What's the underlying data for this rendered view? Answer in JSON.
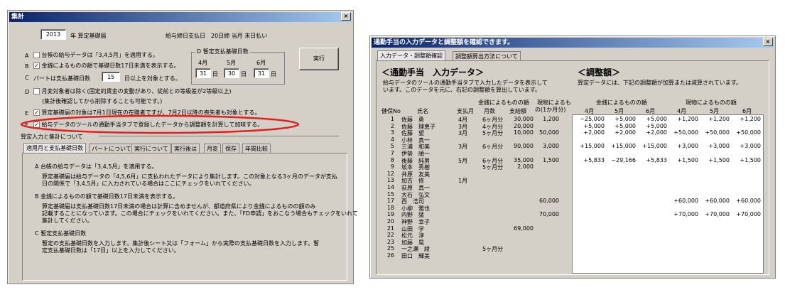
{
  "left": {
    "title": "集計",
    "close": "×",
    "year": "2013",
    "year_suffix": "年 算定基礎届",
    "pay_info": "給与締日支払日　20日締 当月 末日払い",
    "optA": "台帳の給与データは「3,4,5月」を適用する。",
    "optB": "金銭によるものの額で基礎日数17日未満を表示する。",
    "optC_pre": "パートは支払基礎日数",
    "optC_val": "15",
    "optC_post": "日以上を対象とする。",
    "groupD_title": "D 暫定支払基礎日数",
    "months": [
      "4月",
      "5月",
      "6月"
    ],
    "day_vals": [
      "31",
      "30",
      "31"
    ],
    "day_unit": "日",
    "run_button": "実行",
    "optD_line1": "月変対象者は除く(固定的賃金の変動があり、従前との等級差が2等級以上)",
    "optD_line2": "(集計後確認してから削除することも可能です。)",
    "optE": "算定基礎届の対象は7月1日現在の在職者ですが、7月2日以降の喪失者も対象とする。",
    "optF": "給与データのツールの通勤手当タブで登録したデータから調整額を計算して加味する。",
    "letters": [
      "A",
      "B",
      "C",
      "D",
      "E",
      "F"
    ],
    "section_title": "算定入力と集計について",
    "tabs": [
      "適用月と支払基礎日数",
      "パートについて",
      "実行について",
      "実行後は",
      "月変",
      "保存",
      "年間比較"
    ],
    "help": [
      {
        "head": "A 台帳の給与データは「3,4,5月」を適用する。",
        "body": [
          "算定基礎届は給与データの「4,5,6月」に支払われたデータにより集計します。この対象となる3ヶ月のデータが支払",
          "日の関係で「3,4,5月」に入力されている場合はここにチェックをいれてください。"
        ]
      },
      {
        "head": "B 金銭によるものの額で基礎日数17日未満を表示する。",
        "body": [
          "算定基礎届は支払基礎日数17日未満の場合は計算に含めませんが、都道府県により金銭によるものの額のみ",
          "記載することになっています。この場合にチェックをいれてください。また、「FD申請」をおこなう場合もチェックをいれて",
          "集計してください。"
        ]
      },
      {
        "head": "C 暫定支払基礎日数",
        "body": [
          "暫定の支払基礎日数を入力します。集計後シート又は「フォーム」から実際の支払基礎日数を入力します。暫",
          "定支払基礎日数は「17日」以上を入力してください。"
        ]
      }
    ]
  },
  "right": {
    "title": "通勤手当の入力データと調整額を確認できます。",
    "close": "×",
    "tabs": [
      "入力データ・調整額確認",
      "調整額算出方法について"
    ],
    "heading_left": "＜通勤手当　入力データ＞",
    "desc_left": [
      "給与データのツールの通勤手当タブで入力したデータを表示して",
      "います。このデータを元に、右記の調整額を算出しています。"
    ],
    "heading_right": "＜調整額＞",
    "desc_right": "算定データには、下記の調整額が加算または減算されています。",
    "hdr_kinsen": "金銭によるものの額",
    "hdr_genbutsu": "現物によるも",
    "hdr_genbutsu2": "の(1か月分)",
    "hdr_cols": [
      "健保No",
      "氏名",
      "支払月",
      "月数",
      "支給額"
    ],
    "adj_hdr_kinsen": "金銭によるものの額",
    "adj_hdr_genbutsu": "現物によるものの額",
    "adj_months": [
      "4月",
      "5月",
      "6月",
      "4月",
      "5月",
      "6月"
    ],
    "rows": [
      {
        "no": "1",
        "name": "佐藤　勇",
        "m": "4月",
        "cnt": "6ヶ月分",
        "amt": "30,000",
        "gen": "1,200"
      },
      {
        "no": "2",
        "name": "佐藤　理恵子",
        "m": "3月",
        "cnt": "4ヶ月分",
        "amt": "20,000",
        "gen": ""
      },
      {
        "no": "3",
        "name": "佐藤　望",
        "m": "3月",
        "cnt": "5ヶ月分",
        "amt": "10,000",
        "gen": "50,000"
      },
      {
        "no": "4",
        "name": "小林　真一",
        "m": "",
        "cnt": "",
        "amt": "",
        "gen": ""
      },
      {
        "no": "5",
        "name": "三浦　和美",
        "m": "3月",
        "cnt": "6ヶ月分",
        "amt": "90,000",
        "gen": "3,000"
      },
      {
        "no": "7",
        "name": "伊勢　順一",
        "m": "",
        "cnt": "",
        "amt": "",
        "gen": ""
      },
      {
        "no": "8",
        "name": "後藤　純男",
        "m": "5月",
        "cnt": "6ヶ月分",
        "amt": "35,000",
        "gen": "1,500"
      },
      {
        "no": "9",
        "name": "坂本　秀樹",
        "m": "",
        "cnt": "5ヶ月分",
        "amt": "2,000",
        "gen": ""
      },
      {
        "no": "12",
        "name": "井原　友美",
        "m": "",
        "cnt": "",
        "amt": "",
        "gen": ""
      },
      {
        "no": "13",
        "name": "加古　修",
        "m": "1月",
        "cnt": "",
        "amt": "",
        "gen": ""
      },
      {
        "no": "14",
        "name": "荻原　真一",
        "m": "",
        "cnt": "",
        "amt": "",
        "gen": ""
      },
      {
        "no": "15",
        "name": "大石　弘文",
        "m": "",
        "cnt": "",
        "amt": "",
        "gen": ""
      },
      {
        "no": "17",
        "name": "西　浩司",
        "m": "",
        "cnt": "",
        "amt": "",
        "gen": "60,000"
      },
      {
        "no": "18",
        "name": "小柳　雅也",
        "m": "",
        "cnt": "",
        "amt": "",
        "gen": ""
      },
      {
        "no": "19",
        "name": "内野　猛",
        "m": "",
        "cnt": "",
        "amt": "",
        "gen": "70,000"
      },
      {
        "no": "20",
        "name": "神野　幸子",
        "m": "",
        "cnt": "",
        "amt": "",
        "gen": ""
      },
      {
        "no": "21",
        "name": "山田　学",
        "m": "",
        "cnt": "",
        "amt": "69,000",
        "gen": ""
      },
      {
        "no": "22",
        "name": "松元　淳",
        "m": "",
        "cnt": "",
        "amt": "",
        "gen": ""
      },
      {
        "no": "23",
        "name": "加藤　晃",
        "m": "",
        "cnt": "",
        "amt": "",
        "gen": ""
      },
      {
        "no": "25",
        "name": "一之瀬　綾",
        "m": "",
        "cnt": "5ヶ月分",
        "amt": "",
        "gen": ""
      },
      {
        "no": "26",
        "name": "田口　輝美",
        "m": "",
        "cnt": "",
        "amt": "",
        "gen": ""
      }
    ],
    "adj_rows": [
      [
        "−25,000",
        "+5,000",
        "+5,000",
        "+1,200",
        "+1,200",
        "+1,200"
      ],
      [
        "+5,000",
        "+5,000",
        "+5,000",
        "",
        "",
        ""
      ],
      [
        "+2,000",
        "+2,000",
        "+2,000",
        "+50,000",
        "+50,000",
        "+50,000"
      ],
      [
        "",
        "",
        "",
        "",
        "",
        ""
      ],
      [
        "+15,000",
        "+15,000",
        "+15,000",
        "+3,000",
        "+3,000",
        "+3,000"
      ],
      [
        "",
        "",
        "",
        "",
        "",
        ""
      ],
      [
        "+5,833",
        "−29,166",
        "+5,833",
        "+1,500",
        "+1,500",
        "+1,500"
      ],
      [
        "",
        "",
        "",
        "",
        "",
        ""
      ],
      [
        "",
        "",
        "",
        "",
        "",
        ""
      ],
      [
        "",
        "",
        "",
        "",
        "",
        ""
      ],
      [
        "",
        "",
        "",
        "",
        "",
        ""
      ],
      [
        "",
        "",
        "",
        "",
        "",
        ""
      ],
      [
        "",
        "",
        "",
        "+60,000",
        "+60,000",
        "+60,000"
      ],
      [
        "",
        "",
        "",
        "",
        "",
        ""
      ],
      [
        "",
        "",
        "",
        "+70,000",
        "+70,000",
        "+70,000"
      ]
    ]
  }
}
